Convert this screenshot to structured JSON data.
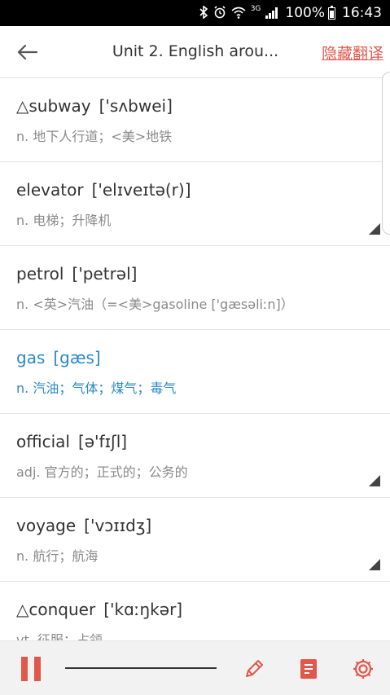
{
  "status_bar": {
    "network": "3G",
    "battery": "100%",
    "time": "16:43",
    "icons": [
      "bluetooth-icon",
      "alarm-icon",
      "wifi-icon",
      "signal-icon",
      "battery-icon"
    ]
  },
  "header": {
    "title": "Unit 2. English arou...",
    "action_label": "隐藏翻译"
  },
  "words": [
    {
      "word": "△subway",
      "phonetic": "['sʌbwei]",
      "translation": "n. 地下人行道；<美>地铁",
      "active": false,
      "corner": false
    },
    {
      "word": "elevator",
      "phonetic": "['elɪveɪtə(r)]",
      "translation": "n. 电梯；升降机",
      "active": false,
      "corner": true
    },
    {
      "word": "petrol",
      "phonetic": "['petrəl]",
      "translation": "n. <英>汽油（=<美>gasoline ['gæsəliːn]）",
      "active": false,
      "corner": false
    },
    {
      "word": "gas",
      "phonetic": "[gæs]",
      "translation": "n. 汽油；气体；煤气；毒气",
      "active": true,
      "corner": false
    },
    {
      "word": "official",
      "phonetic": "[ə'fɪʃl]",
      "translation": "adj. 官方的；正式的；公务的",
      "active": false,
      "corner": true
    },
    {
      "word": "voyage",
      "phonetic": "['vɔɪɪdʒ]",
      "translation": "n. 航行；航海",
      "active": false,
      "corner": true
    },
    {
      "word": "△conquer",
      "phonetic": "['kɑːŋkər]",
      "translation": "vt. 征服；占领",
      "active": false,
      "corner": false
    }
  ],
  "colors": {
    "accent": "#e2574c",
    "active_word": "#2a8ac8"
  }
}
